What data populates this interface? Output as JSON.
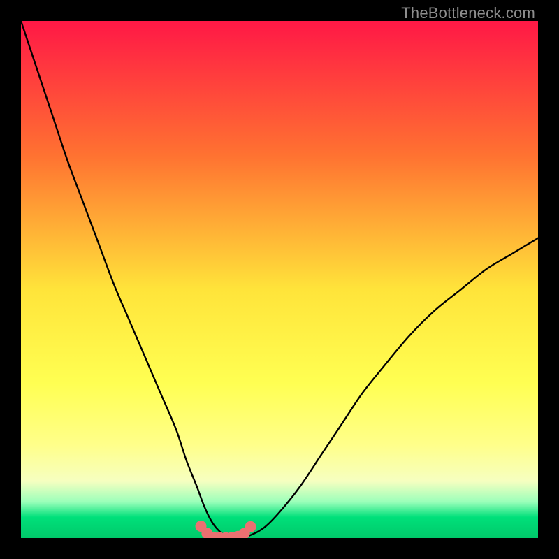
{
  "watermark": "TheBottleneck.com",
  "colors": {
    "black": "#000000",
    "curve": "#000000",
    "dots": "#ec7071",
    "gradient_top": "#ff1846",
    "gradient_mid_upper": "#ff8f2e",
    "gradient_mid": "#ffe43a",
    "gradient_mid_lower": "#ffff8a",
    "gradient_low": "#f6ffc0",
    "gradient_green1": "#9bffba",
    "gradient_green2": "#00e07a",
    "gradient_green3": "#00c96a"
  },
  "chart_data": {
    "type": "line",
    "title": "",
    "xlabel": "",
    "ylabel": "",
    "xlim": [
      0,
      100
    ],
    "ylim": [
      0,
      100
    ],
    "series": [
      {
        "name": "bottleneck-curve",
        "x": [
          0,
          3,
          6,
          9,
          12,
          15,
          18,
          21,
          24,
          27,
          30,
          32,
          34,
          35.5,
          37,
          38.5,
          40,
          42,
          44,
          47,
          50,
          54,
          58,
          62,
          66,
          70,
          75,
          80,
          85,
          90,
          95,
          100
        ],
        "y": [
          100,
          91,
          82,
          73,
          65,
          57,
          49,
          42,
          35,
          28,
          21,
          15,
          10,
          6,
          3,
          1.2,
          0.2,
          0.1,
          0.4,
          2,
          5,
          10,
          16,
          22,
          28,
          33,
          39,
          44,
          48,
          52,
          55,
          58
        ]
      }
    ],
    "flat_bottom_dots": {
      "name": "marker-dots",
      "x": [
        34.8,
        36.0,
        37.2,
        38.4,
        39.6,
        40.8,
        42.0,
        43.2,
        44.4
      ],
      "y": [
        2.3,
        0.9,
        0.15,
        0.05,
        0.05,
        0.1,
        0.3,
        0.9,
        2.2
      ]
    }
  }
}
